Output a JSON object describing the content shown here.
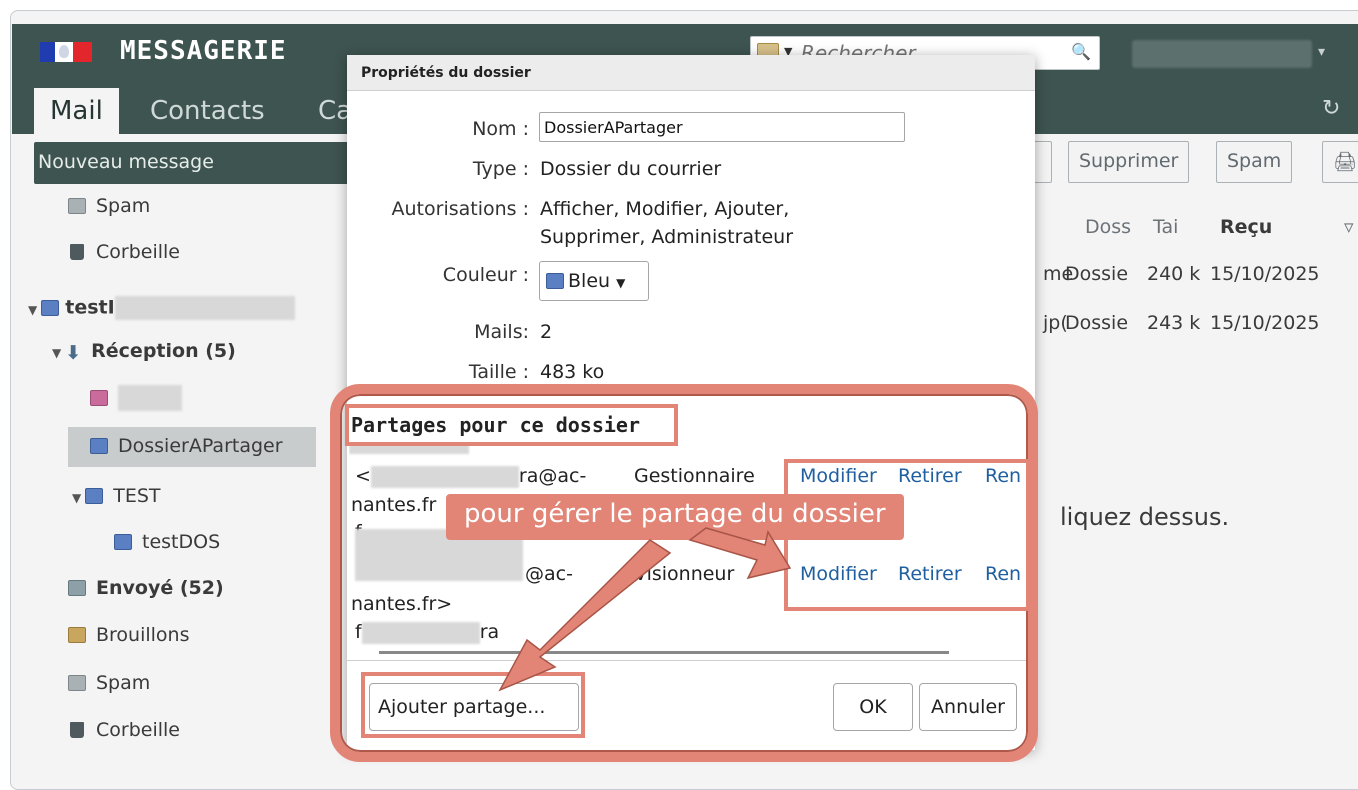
{
  "header": {
    "app_title": "MESSAGERIE",
    "search_placeholder": "Rechercher"
  },
  "nav": {
    "tabs": [
      "Mail",
      "Contacts",
      "Ca"
    ]
  },
  "toolbar": {
    "new_message": "Nouveau message",
    "delete": "Supprimer",
    "spam": "Spam"
  },
  "sidebar": {
    "spam_top": "Spam",
    "trash_top": "Corbeille",
    "account": "testI",
    "inbox": "Réception (5)",
    "folder_selected": "DossierAPartager",
    "folder_test": "TEST",
    "folder_testdos": "testDOS",
    "sent": "Envoyé (52)",
    "drafts": "Brouillons",
    "spam": "Spam",
    "trash": "Corbeille"
  },
  "message_list": {
    "columns": [
      "Doss",
      "Tai",
      "Reçu"
    ],
    "rows": [
      {
        "subject": "me",
        "folder": "Dossie",
        "size": "240 k",
        "date": "15/10/2025"
      },
      {
        "subject": "jp(",
        "folder": "Dossie",
        "size": "243 k",
        "date": "15/10/2025"
      }
    ],
    "hint": "liquez dessus."
  },
  "dialog": {
    "title": "Propriétés du dossier",
    "labels": {
      "name": "Nom :",
      "type": "Type :",
      "permissions": "Autorisations :",
      "color": "Couleur :",
      "mails": "Mails:",
      "size": "Taille :"
    },
    "values": {
      "name": "DossierAPartager",
      "type": "Dossier du courrier",
      "permissions_line1": "Afficher, Modifier, Ajouter,",
      "permissions_line2": "Supprimer, Administrateur",
      "color": "Bleu",
      "mails": "2",
      "size": "483 ko"
    },
    "shares_title": "Partages pour ce dossier",
    "shares": [
      {
        "email_start": "<",
        "email_end": "ra@ac-",
        "email_domain": "nantes.fr",
        "role": "Gestionnaire",
        "modify": "Modifier",
        "remove": "Retirer",
        "rename": "Ren"
      },
      {
        "email_start": "f",
        "email_end": "@ac-",
        "email_domain": "nantes.fr>",
        "role": "Visionneur",
        "modify": "Modifier",
        "remove": "Retirer",
        "rename": "Ren"
      },
      {
        "email_start": "f",
        "email_end": "ra"
      }
    ],
    "buttons": {
      "add_share": "Ajouter partage...",
      "ok": "OK",
      "cancel": "Annuler"
    }
  },
  "annotation": {
    "label": "pour gérer le partage du dossier",
    "color": "#e28576"
  }
}
